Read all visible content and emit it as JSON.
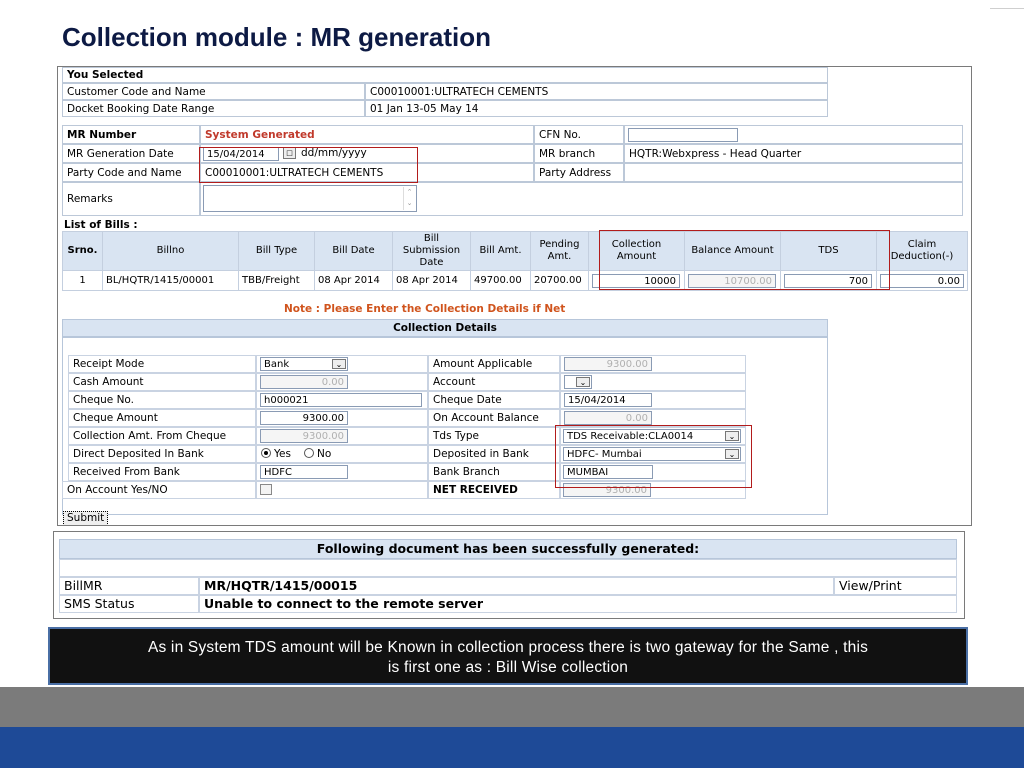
{
  "slide_title": "Collection module : MR generation",
  "selected": {
    "header": "You Selected",
    "customer_label": "Customer Code and Name",
    "customer_value": "C00010001:ULTRATECH CEMENTS",
    "docket_label": "Docket Booking Date Range",
    "docket_value": "01 Jan 13-05 May 14"
  },
  "mr": {
    "number_label": "MR Number",
    "number_value": "System Generated",
    "cfn_label": "CFN No.",
    "cfn_value": "",
    "gen_date_label": "MR Generation Date",
    "gen_date_value": "15/04/2014",
    "date_format": "dd/mm/yyyy",
    "branch_label": "MR branch",
    "branch_value": "HQTR:Webxpress - Head Quarter",
    "party_label": "Party Code and Name",
    "party_value": "C00010001:ULTRATECH CEMENTS",
    "party_address_label": "Party Address",
    "remarks_label": "Remarks"
  },
  "bills": {
    "section_label": "List of Bills :",
    "columns": [
      "Srno.",
      "Billno",
      "Bill Type",
      "Bill Date",
      "Bill Submission Date",
      "Bill Amt.",
      "Pending Amt.",
      "Collection Amount",
      "Balance Amount",
      "TDS",
      "Claim Deduction(-)"
    ],
    "rows": [
      {
        "srno": "1",
        "billno": "BL/HQTR/1415/00001",
        "type": "TBB/Freight",
        "date": "08 Apr 2014",
        "submission": "08 Apr 2014",
        "amt": "49700.00",
        "pending": "20700.00",
        "collection": "10000",
        "balance": "10700.00",
        "tds": "700",
        "claim": "0.00"
      }
    ]
  },
  "note": "Note : Please Enter the Collection Details if Net",
  "collection": {
    "header": "Collection Details",
    "receipt_mode_label": "Receipt Mode",
    "receipt_mode_value": "Bank",
    "amount_applicable_label": "Amount Applicable",
    "amount_applicable_value": "9300.00",
    "cash_amount_label": "Cash Amount",
    "cash_amount_value": "0.00",
    "account_label": "Account",
    "account_value": "",
    "cheque_no_label": "Cheque No.",
    "cheque_no_value": "h000021",
    "cheque_date_label": "Cheque Date",
    "cheque_date_value": "15/04/2014",
    "cheque_amount_label": "Cheque Amount",
    "cheque_amount_value": "9300.00",
    "on_account_balance_label": "On Account Balance",
    "on_account_balance_value": "0.00",
    "coll_from_cheque_label": "Collection Amt. From Cheque",
    "coll_from_cheque_value": "9300.00",
    "tds_type_label": "Tds Type",
    "tds_type_value": "TDS Receivable:CLA0014",
    "direct_deposit_label": "Direct Deposited In Bank",
    "yes_label": "Yes",
    "no_label": "No",
    "deposited_in_bank_label": "Deposited in Bank",
    "deposited_in_bank_value": "HDFC- Mumbai",
    "received_from_bank_label": "Received From Bank",
    "received_from_bank_value": "HDFC",
    "bank_branch_label": "Bank Branch",
    "bank_branch_value": "MUMBAI",
    "on_account_label": "On Account Yes/NO",
    "net_received_label": "NET RECEIVED",
    "net_received_value": "9300.00",
    "submit_label": "Submit"
  },
  "success": {
    "message": "Following document has been successfully generated:",
    "billmr_label": "BillMR",
    "billmr_value": "MR/HQTR/1415/00015",
    "view_print": "View/Print",
    "sms_label": "SMS Status",
    "sms_value": "Unable to connect to the remote server"
  },
  "caption": {
    "line1": "As in System TDS amount will be Known in collection process there is two gateway for the Same , this",
    "line2": "is first one as : Bill Wise collection"
  }
}
